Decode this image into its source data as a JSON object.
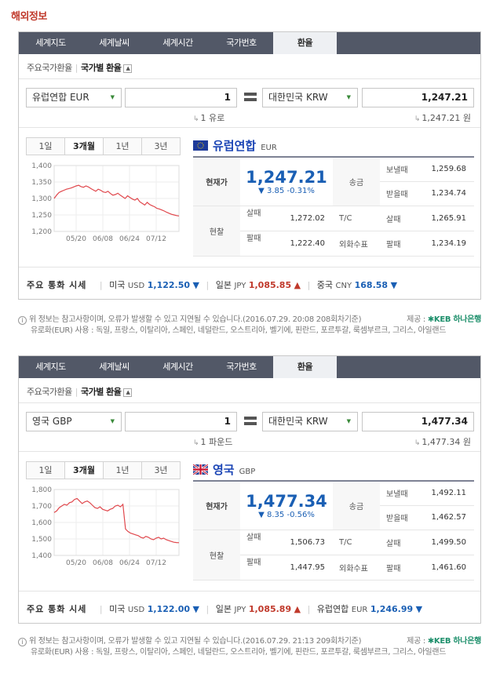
{
  "page_title": "해외정보",
  "tabs": [
    "세계지도",
    "세계날씨",
    "세계시간",
    "국가번호",
    "환율"
  ],
  "subtabs": {
    "a": "주요국가환율",
    "b": "국가별 환율"
  },
  "periods": [
    "1일",
    "3개월",
    "1년",
    "3년"
  ],
  "common": {
    "current_label": "현재가",
    "remit_label": "송금",
    "send_label": "보낼때",
    "recv_label": "받을때",
    "cash_label": "현찰",
    "buy_label": "살때",
    "sell_label": "팔때",
    "tc_label": "T/C",
    "check_label": "외화수표",
    "major_label": "주요 통화 시세",
    "target_select": "대한민국 KRW",
    "amount": "1"
  },
  "widgets": [
    {
      "source_select": "유럽연합 EUR",
      "result": "1,247.21",
      "unit_left": "1 유로",
      "unit_right": "1,247.21 원",
      "country": "유럽연합",
      "code": "EUR",
      "price": "1,247.21",
      "change": "▼ 3.85 -0.31%",
      "send": "1,259.68",
      "recv": "1,234.74",
      "cash_buy": "1,272.02",
      "cash_sell": "1,222.40",
      "tc_buy": "1,265.91",
      "check_sell": "1,234.19",
      "major": [
        {
          "country": "미국",
          "code": "USD",
          "value": "1,122.50",
          "dir": "▼"
        },
        {
          "country": "일본",
          "code": "JPY",
          "value": "1,085.85",
          "dir": "▲"
        },
        {
          "country": "중국",
          "code": "CNY",
          "value": "168.58",
          "dir": "▼"
        }
      ],
      "notice_line1": "위 정보는 참고사항이며, 오류가 발생할 수 있고 지연될 수 있습니다.(2016.07.29. 20:08 208회차기준)",
      "notice_line2": "유로화(EUR) 사용 : 독일, 프랑스, 이탈리아, 스페인, 네덜란드, 오스트리아, 벨기에, 핀란드, 포르투갈, 룩셈부르크, 그리스, 아일랜드"
    },
    {
      "source_select": "영국 GBP",
      "result": "1,477.34",
      "unit_left": "1 파운드",
      "unit_right": "1,477.34 원",
      "country": "영국",
      "code": "GBP",
      "price": "1,477.34",
      "change": "▼ 8.35 -0.56%",
      "send": "1,492.11",
      "recv": "1,462.57",
      "cash_buy": "1,506.73",
      "cash_sell": "1,447.95",
      "tc_buy": "1,499.50",
      "check_sell": "1,461.60",
      "major": [
        {
          "country": "미국",
          "code": "USD",
          "value": "1,122.00",
          "dir": "▼"
        },
        {
          "country": "일본",
          "code": "JPY",
          "value": "1,085.89",
          "dir": "▲"
        },
        {
          "country": "유럽연합",
          "code": "EUR",
          "value": "1,246.99",
          "dir": "▼"
        }
      ],
      "notice_line1": "위 정보는 참고사항이며, 오류가 발생할 수 있고 지연될 수 있습니다.(2016.07.29. 21:13 209회차기준)",
      "notice_line2": "유로화(EUR) 사용 : 독일, 프랑스, 이탈리아, 스페인, 네덜란드, 오스트리아, 벨기에, 핀란드, 포르투갈, 룩셈부르크, 그리스, 아일랜드"
    }
  ],
  "notice_source": "제공 :",
  "bank_name": "KEB 하나은행",
  "chart_data": [
    {
      "type": "line",
      "x_ticks": [
        "05/20",
        "06/08",
        "06/24",
        "07/12"
      ],
      "y_ticks": [
        "1,400",
        "1,350",
        "1,300",
        "1,250",
        "1,200"
      ],
      "ylim": [
        1200,
        1400
      ],
      "values": [
        1300,
        1310,
        1318,
        1322,
        1325,
        1328,
        1330,
        1332,
        1335,
        1338,
        1340,
        1336,
        1334,
        1338,
        1335,
        1330,
        1326,
        1322,
        1328,
        1325,
        1320,
        1318,
        1322,
        1315,
        1310,
        1312,
        1316,
        1310,
        1305,
        1300,
        1308,
        1303,
        1298,
        1295,
        1300,
        1290,
        1285,
        1280,
        1288,
        1282,
        1278,
        1275,
        1270,
        1268,
        1265,
        1262,
        1258,
        1255,
        1252,
        1250,
        1248,
        1247
      ]
    },
    {
      "type": "line",
      "x_ticks": [
        "05/20",
        "06/08",
        "06/24",
        "07/12"
      ],
      "y_ticks": [
        "1,800",
        "1,700",
        "1,600",
        "1,500",
        "1,400"
      ],
      "ylim": [
        1400,
        1800
      ],
      "values": [
        1660,
        1670,
        1690,
        1700,
        1710,
        1705,
        1720,
        1725,
        1740,
        1745,
        1730,
        1715,
        1725,
        1730,
        1720,
        1705,
        1690,
        1685,
        1695,
        1680,
        1675,
        1670,
        1680,
        1685,
        1700,
        1705,
        1695,
        1710,
        1560,
        1545,
        1535,
        1530,
        1525,
        1520,
        1510,
        1505,
        1515,
        1510,
        1500,
        1495,
        1505,
        1510,
        1500,
        1505,
        1495,
        1490,
        1485,
        1480,
        1478,
        1477
      ]
    }
  ]
}
